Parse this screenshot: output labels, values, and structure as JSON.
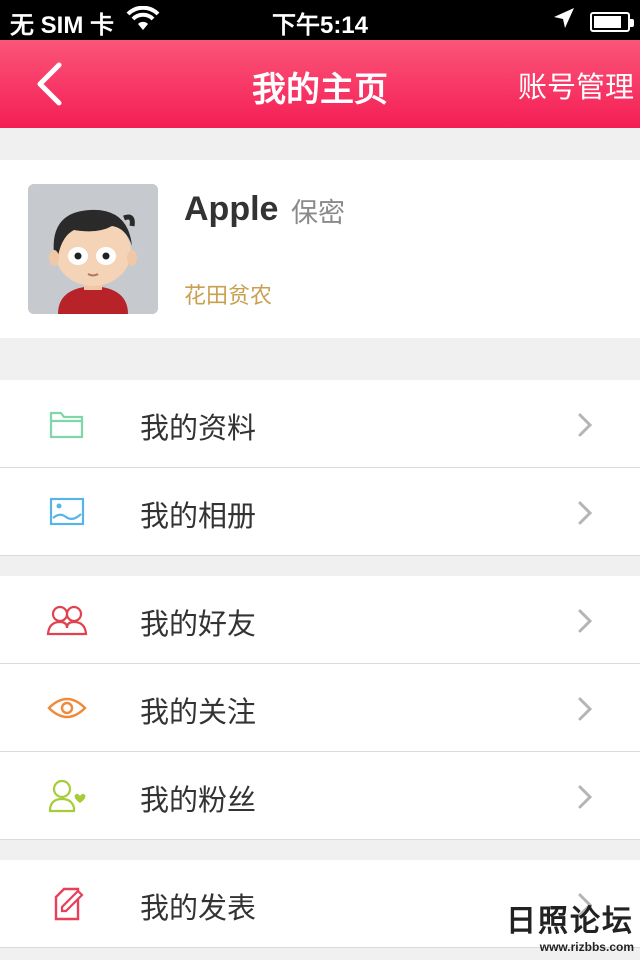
{
  "status_bar": {
    "carrier": "无 SIM 卡",
    "time": "下午5:14",
    "battery_level": 0.85
  },
  "nav": {
    "title": "我的主页",
    "right_label": "账号管理",
    "back_icon": "chevron-left-icon"
  },
  "profile": {
    "name": "Apple",
    "gender": "保密",
    "level": "花田贫农",
    "avatar_icon": "cartoon-boy-avatar"
  },
  "menu": {
    "groups": [
      [
        {
          "label": "我的资料",
          "icon": "folder-icon",
          "color": "#7fd6a8"
        },
        {
          "label": "我的相册",
          "icon": "picture-icon",
          "color": "#56b4e9"
        }
      ],
      [
        {
          "label": "我的好友",
          "icon": "friends-icon",
          "color": "#e0434e"
        },
        {
          "label": "我的关注",
          "icon": "eye-icon",
          "color": "#ee8a3a"
        },
        {
          "label": "我的粉丝",
          "icon": "user-heart-icon",
          "color": "#a6cc3a"
        }
      ],
      [
        {
          "label": "我的发表",
          "icon": "edit-icon",
          "color": "#e8405a"
        }
      ]
    ]
  },
  "watermark": {
    "title": "日照论坛",
    "url": "www.rizbbs.com"
  },
  "colors": {
    "nav_top": "#fb5579",
    "nav_bottom": "#f41e55",
    "level_text": "#c9a050",
    "background": "#f0f0f0"
  }
}
